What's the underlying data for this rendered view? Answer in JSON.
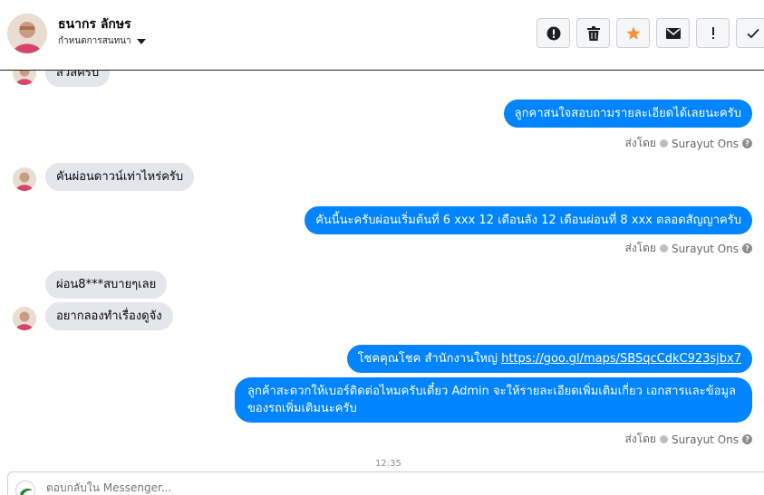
{
  "header": {
    "contact_name": "ธนากร ลักษร",
    "assign_label": "กำหนดการสนทนา",
    "actions": [
      {
        "name": "alert-icon",
        "glyph": "!"
      },
      {
        "name": "trash-icon",
        "glyph": ""
      },
      {
        "name": "star-icon",
        "glyph": "★"
      },
      {
        "name": "mail-icon",
        "glyph": ""
      },
      {
        "name": "exclamation-icon",
        "glyph": "!"
      },
      {
        "name": "check-icon",
        "glyph": "✓"
      }
    ]
  },
  "messages": {
    "m0": "สวัสครับ",
    "m1": "ลูกคาสนใจสอบถามรายละเอียดได้เลยนะครับ",
    "m2": "คันผ่อนดาวน์เท่าไหร่ครับ",
    "m3": "คันนี้นะครับผ่อนเริ่มต้นที่ 6 xxx 12 เดือนลัง 12 เดือนผ่อนที่ 8 xxx ตลอดสัญญาครับ",
    "m4": "ผ่อน8***สบายๆเลย",
    "m5": "อยากลองทำเรื่องดูจัง",
    "m6_prefix": "โชคคุณโชค สำนักงานใหญ่ ",
    "m6_link": "https://goo.gl/maps/SBSqcCdkC923sjbx7",
    "m7": "ลูกค้าสะดวกให้เบอร์ติดต่อไหมครับเดี๋ยว Admin จะให้รายละเอียดเพิ่มเติมเกี่ยว เอกสารและข้อมูลของรถเพิ่มเติมนะครับ"
  },
  "sent_by": {
    "prefix": "ส่งโดย",
    "name": "Surayut Ons",
    "help": "?"
  },
  "timestamp": "12:35",
  "composer": {
    "placeholder": "ตอบกลับใน Messenger..."
  },
  "colors": {
    "outgoing": "#0084ff",
    "incoming": "#e4e6eb",
    "star": "#f7923b"
  }
}
